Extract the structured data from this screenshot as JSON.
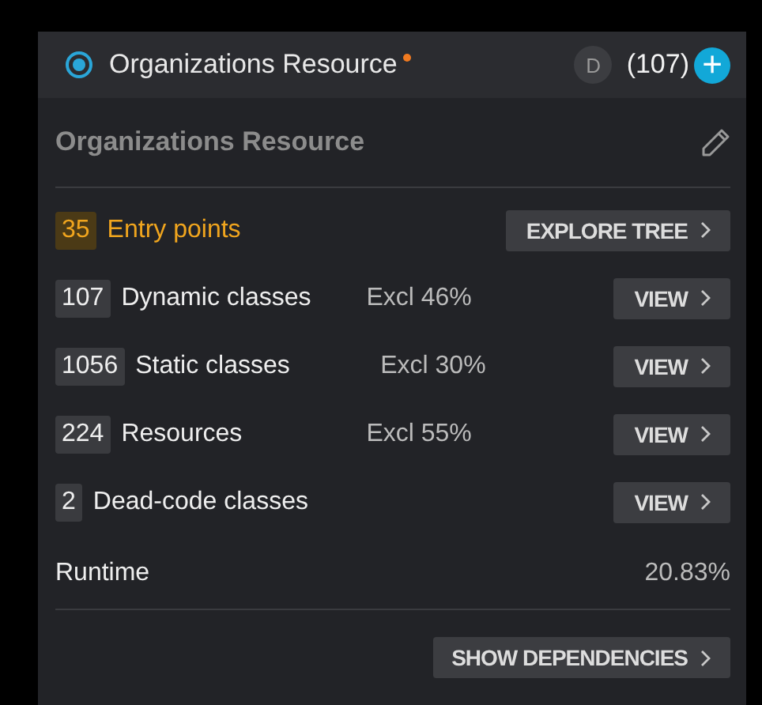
{
  "header": {
    "title": "Organizations Resource",
    "selected": true,
    "modified": true,
    "badge": "D",
    "count": "(107)",
    "add_icon": "+"
  },
  "subtitle": "Organizations Resource",
  "rows": [
    {
      "kind": "entry",
      "count": "35",
      "label": "Entry points",
      "button": "EXPLORE TREE"
    },
    {
      "kind": "stat",
      "count": "107",
      "label": "Dynamic classes",
      "excl": "Excl 46%",
      "button": "VIEW"
    },
    {
      "kind": "stat",
      "count": "1056",
      "label": "Static classes",
      "excl": "Excl 30%",
      "button": "VIEW"
    },
    {
      "kind": "stat",
      "count": "224",
      "label": "Resources",
      "excl": "Excl 55%",
      "button": "VIEW"
    },
    {
      "kind": "stat",
      "count": "2",
      "label": "Dead-code classes",
      "button": "VIEW"
    }
  ],
  "runtime": {
    "label": "Runtime",
    "value": "20.83%"
  },
  "footer_button": "SHOW DEPENDENCIES"
}
